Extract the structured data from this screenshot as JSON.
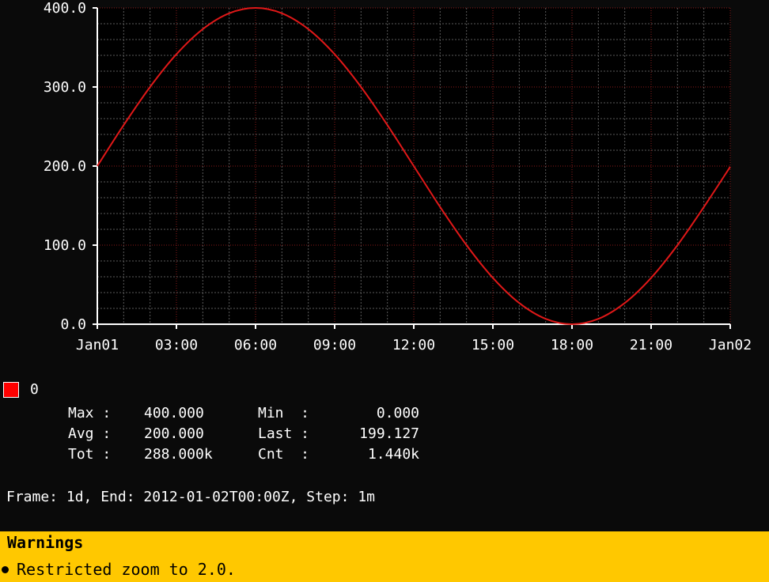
{
  "chart_data": {
    "type": "line",
    "title": "",
    "xlabel": "",
    "ylabel": "",
    "x_ticks": [
      "Jan01",
      "03:00",
      "06:00",
      "09:00",
      "12:00",
      "15:00",
      "18:00",
      "21:00",
      "Jan02"
    ],
    "y_ticks": [
      "0.0",
      "100.0",
      "200.0",
      "300.0",
      "400.0"
    ],
    "ylim": [
      0,
      400
    ],
    "x_range_hours": [
      0,
      24
    ],
    "grid": true,
    "series": [
      {
        "name": "0",
        "color": "#e01818",
        "x_hours": [
          0,
          1,
          2,
          3,
          4,
          5,
          6,
          7,
          8,
          9,
          10,
          11,
          12,
          13,
          14,
          15,
          16,
          17,
          18,
          19,
          20,
          21,
          22,
          23,
          24
        ],
        "values": [
          200.0,
          251.8,
          300.0,
          341.4,
          373.2,
          393.2,
          400.0,
          393.2,
          373.2,
          341.4,
          300.0,
          251.8,
          200.0,
          148.2,
          100.0,
          58.6,
          26.8,
          6.8,
          0.0,
          6.8,
          26.8,
          58.6,
          100.0,
          148.2,
          199.1
        ]
      }
    ]
  },
  "legend": {
    "swatch_color": "#ff0000",
    "label": "0"
  },
  "stats": [
    {
      "k1": "Max :",
      "v1": "400.000",
      "k2": "Min  :",
      "v2": "0.000"
    },
    {
      "k1": "Avg :",
      "v1": "200.000",
      "k2": "Last :",
      "v2": "199.127"
    },
    {
      "k1": "Tot :",
      "v1": "288.000k",
      "k2": "Cnt  :",
      "v2": "1.440k"
    }
  ],
  "frame_text": "Frame: 1d, End: 2012-01-02T00:00Z, Step: 1m",
  "warnings": {
    "title": "Warnings",
    "items": [
      "Restricted zoom to 2.0."
    ],
    "bg_color": "#ffc800"
  }
}
